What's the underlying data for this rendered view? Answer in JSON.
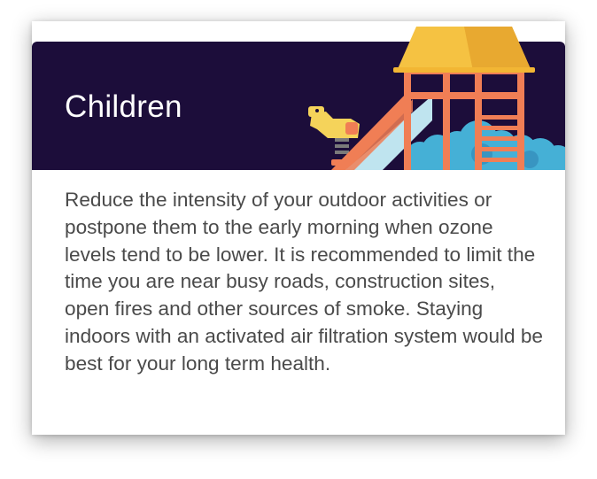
{
  "card": {
    "title": "Children",
    "illustration_icon": "playground-icon",
    "description": "Reduce the intensity of your outdoor activities or postpone them to the early morning when ozone levels tend to be lower. It is recommended to limit the time you are near busy roads, construction sites, open fires and other sources of smoke. Staying indoors with an activated air filtration system would be best for your long term health."
  },
  "colors": {
    "banner_background": "#1c0d3a",
    "title_text": "#ffffff",
    "body_text": "#4a4a4a",
    "roof": "#f5c242",
    "frame": "#f07e55",
    "slide": "#bfe4ef",
    "bushes": "#45b0d6"
  }
}
